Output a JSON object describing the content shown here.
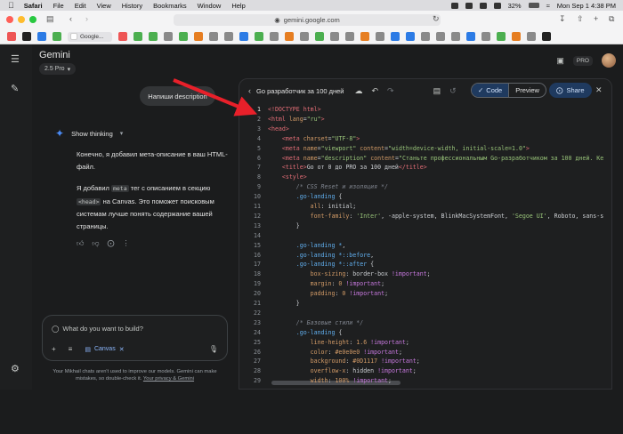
{
  "menubar": {
    "app": "Safari",
    "items": [
      "File",
      "Edit",
      "View",
      "History",
      "Bookmarks",
      "Window",
      "Help"
    ],
    "battery": "32%",
    "datetime": "Mon Sep 1  4:38 PM"
  },
  "browser": {
    "url": "gemini.google.com",
    "tab_label": "Google..."
  },
  "gemini": {
    "title": "Gemini",
    "model": "2.5 Pro",
    "pro_badge": "PRO",
    "user_message": "Напиши description",
    "show_thinking": "Show thinking",
    "response_p1": "Конечно, я добавил мета-описание в ваш HTML-файл.",
    "response_p2_a": "Я добавил ",
    "response_p2_code1": "meta",
    "response_p2_b": " тег с описанием в секцию ",
    "response_p2_code2": "<head>",
    "response_p2_c": " на Canvas. Это поможет поисковым системам лучше понять содержание вашей страницы.",
    "input_placeholder": "What do you want to build?",
    "canvas_chip": "Canvas",
    "footer": "Your Mikhail chats aren't used to improve our models. Gemini can make mistakes, so double-check it.",
    "footer_link": "Your privacy & Gemini"
  },
  "panel": {
    "title": "Go разработчик за 100 дней",
    "code_tab": "Code",
    "preview_tab": "Preview",
    "share": "Share"
  },
  "colors": {
    "accent": "#1f3a5f",
    "accent_text": "#d2e3fc",
    "arrow": "#e8202a"
  },
  "code_lines": [
    [
      [
        "t",
        "<!DOCTYPE html>"
      ]
    ],
    [
      [
        "t",
        "<html "
      ],
      [
        "a",
        "lang"
      ],
      [
        "p",
        "="
      ],
      [
        "s",
        "\"ru\""
      ],
      [
        "t",
        ">"
      ]
    ],
    [
      [
        "t",
        "<head>"
      ]
    ],
    [
      [
        "p",
        "    "
      ],
      [
        "t",
        "<meta "
      ],
      [
        "a",
        "charset"
      ],
      [
        "p",
        "="
      ],
      [
        "s",
        "\"UTF-8\""
      ],
      [
        "t",
        ">"
      ]
    ],
    [
      [
        "p",
        "    "
      ],
      [
        "t",
        "<meta "
      ],
      [
        "a",
        "name"
      ],
      [
        "p",
        "="
      ],
      [
        "s",
        "\"viewport\""
      ],
      [
        "p",
        " "
      ],
      [
        "a",
        "content"
      ],
      [
        "p",
        "="
      ],
      [
        "s",
        "\"width=device-width, initial-scale=1.0\""
      ],
      [
        "t",
        ">"
      ]
    ],
    [
      [
        "p",
        "    "
      ],
      [
        "t",
        "<meta "
      ],
      [
        "a",
        "name"
      ],
      [
        "p",
        "="
      ],
      [
        "s",
        "\"description\""
      ],
      [
        "p",
        " "
      ],
      [
        "a",
        "content"
      ],
      [
        "p",
        "="
      ],
      [
        "s",
        "\"Станьте профессиональным Go-разработчиком за 100 дней. Ке"
      ]
    ],
    [
      [
        "p",
        "    "
      ],
      [
        "t",
        "<title>"
      ],
      [
        "p",
        "Go от 0 до PRO за 100 дней"
      ],
      [
        "t",
        "</title>"
      ]
    ],
    [
      [
        "p",
        "    "
      ],
      [
        "t",
        "<style>"
      ]
    ],
    [
      [
        "p",
        "        "
      ],
      [
        "c",
        "/* CSS Reset и изоляция */"
      ]
    ],
    [
      [
        "p",
        "        "
      ],
      [
        "v",
        ".go-landing"
      ],
      [
        "p",
        " {"
      ]
    ],
    [
      [
        "p",
        "            "
      ],
      [
        "a",
        "all"
      ],
      [
        "p",
        ": initial;"
      ]
    ],
    [
      [
        "p",
        "            "
      ],
      [
        "a",
        "font-family"
      ],
      [
        "p",
        ": "
      ],
      [
        "s",
        "'Inter'"
      ],
      [
        "p",
        ", -apple-system, BlinkMacSystemFont, "
      ],
      [
        "s",
        "'Segoe UI'"
      ],
      [
        "p",
        ", Roboto, sans-s"
      ]
    ],
    [
      [
        "p",
        "        }"
      ]
    ],
    [
      [
        "p",
        ""
      ]
    ],
    [
      [
        "p",
        "        "
      ],
      [
        "v",
        ".go-landing *"
      ],
      [
        "p",
        ","
      ]
    ],
    [
      [
        "p",
        "        "
      ],
      [
        "v",
        ".go-landing *::before"
      ],
      [
        "p",
        ","
      ]
    ],
    [
      [
        "p",
        "        "
      ],
      [
        "v",
        ".go-landing *::after"
      ],
      [
        "p",
        " {"
      ]
    ],
    [
      [
        "p",
        "            "
      ],
      [
        "a",
        "box-sizing"
      ],
      [
        "p",
        ": border-box "
      ],
      [
        "k",
        "!important"
      ],
      [
        "p",
        ";"
      ]
    ],
    [
      [
        "p",
        "            "
      ],
      [
        "a",
        "margin"
      ],
      [
        "p",
        ": "
      ],
      [
        "a",
        "0"
      ],
      [
        "p",
        " "
      ],
      [
        "k",
        "!important"
      ],
      [
        "p",
        ";"
      ]
    ],
    [
      [
        "p",
        "            "
      ],
      [
        "a",
        "padding"
      ],
      [
        "p",
        ": "
      ],
      [
        "a",
        "0"
      ],
      [
        "p",
        " "
      ],
      [
        "k",
        "!important"
      ],
      [
        "p",
        ";"
      ]
    ],
    [
      [
        "p",
        "        }"
      ]
    ],
    [
      [
        "p",
        ""
      ]
    ],
    [
      [
        "p",
        "        "
      ],
      [
        "c",
        "/* Базовые стили */"
      ]
    ],
    [
      [
        "p",
        "        "
      ],
      [
        "v",
        ".go-landing"
      ],
      [
        "p",
        " {"
      ]
    ],
    [
      [
        "p",
        "            "
      ],
      [
        "a",
        "line-height"
      ],
      [
        "p",
        ": "
      ],
      [
        "a",
        "1.6"
      ],
      [
        "p",
        " "
      ],
      [
        "k",
        "!important"
      ],
      [
        "p",
        ";"
      ]
    ],
    [
      [
        "p",
        "            "
      ],
      [
        "a",
        "color"
      ],
      [
        "p",
        ": "
      ],
      [
        "a",
        "#e0e0e0"
      ],
      [
        "p",
        " "
      ],
      [
        "k",
        "!important"
      ],
      [
        "p",
        ";"
      ]
    ],
    [
      [
        "p",
        "            "
      ],
      [
        "a",
        "background"
      ],
      [
        "p",
        ": "
      ],
      [
        "a",
        "#0D1117"
      ],
      [
        "p",
        " "
      ],
      [
        "k",
        "!important"
      ],
      [
        "p",
        ";"
      ]
    ],
    [
      [
        "p",
        "            "
      ],
      [
        "a",
        "overflow-x"
      ],
      [
        "p",
        ": hidden "
      ],
      [
        "k",
        "!important"
      ],
      [
        "p",
        ";"
      ]
    ],
    [
      [
        "p",
        "            "
      ],
      [
        "a",
        "width"
      ],
      [
        "p",
        ": "
      ],
      [
        "a",
        "100%"
      ],
      [
        "p",
        " "
      ],
      [
        "k",
        "!important"
      ],
      [
        "p",
        ";"
      ]
    ]
  ]
}
